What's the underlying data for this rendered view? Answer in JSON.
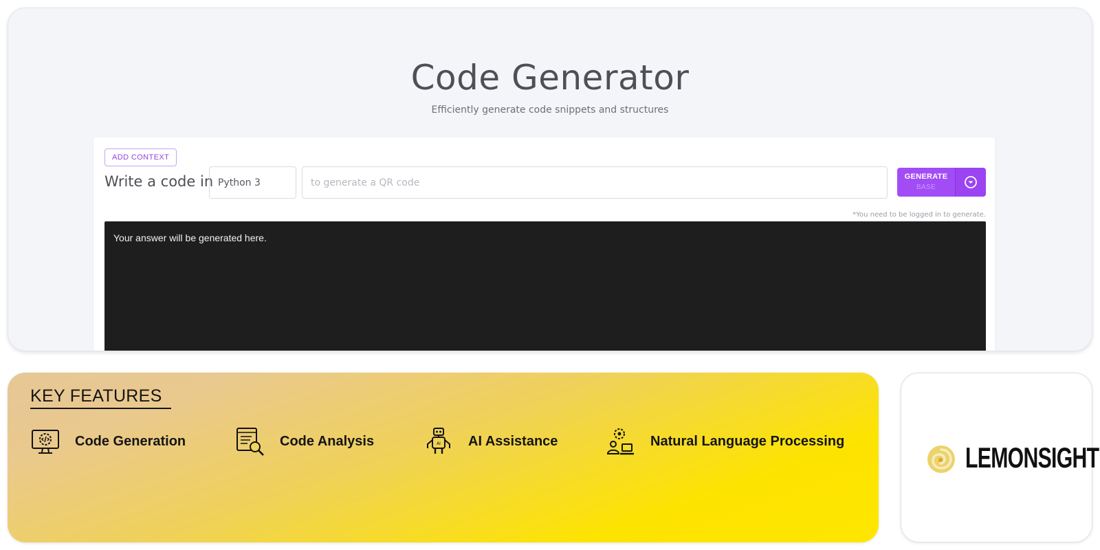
{
  "header": {
    "title": "Code Generator",
    "subtitle": "Efficiently generate code snippets and structures"
  },
  "form": {
    "add_context_label": "ADD CONTEXT",
    "write_label": "Write a code in",
    "language_value": "Python 3",
    "prompt_placeholder": "to generate a QR code",
    "generate_label": "GENERATE",
    "generate_sublabel": "BASE",
    "login_note": "*You need to be logged in to generate."
  },
  "output": {
    "placeholder_text": "Your answer will be generated here."
  },
  "features": {
    "title": "KEY FEATURES",
    "items": [
      {
        "label": "Code Generation",
        "icon": "monitor-gear-icon"
      },
      {
        "label": "Code Analysis",
        "icon": "document-search-icon"
      },
      {
        "label": "AI Assistance",
        "icon": "robot-icon"
      },
      {
        "label": "Natural Language Processing",
        "icon": "person-gear-icon"
      }
    ]
  },
  "brand": {
    "logo_text": "LEMONSIGHT",
    "logo_icon": "lemon-swirl-icon"
  },
  "colors": {
    "accent": "#a24cf6",
    "features_gradient_end": "#ffe600"
  }
}
